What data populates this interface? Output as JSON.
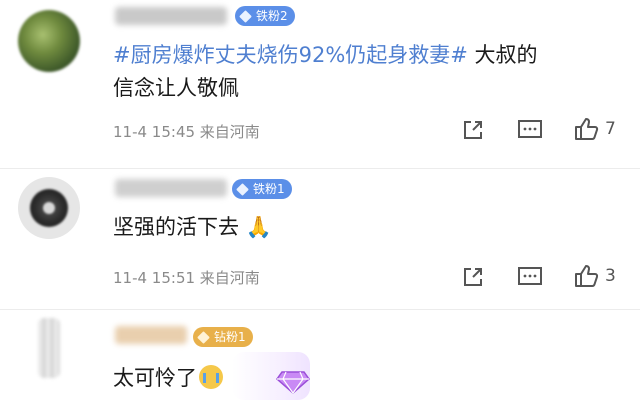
{
  "comments": [
    {
      "badge": "铁粉2",
      "topic": "#厨房爆炸丈夫烧伤92%仍起身救妻#",
      "text_line1_tail": " 大叔的",
      "text_line2": "信念让人敬佩",
      "meta": "11-4 15:45 来自河南",
      "likes": "7"
    },
    {
      "badge": "铁粉1",
      "text": "坚强的活下去",
      "meta": "11-4 15:51 来自河南",
      "likes": "3"
    },
    {
      "badge": "钻粉1",
      "text": "太可怜了"
    }
  ],
  "icons": [
    "share-icon",
    "comment-icon",
    "like-icon",
    "pray-emoji",
    "crying-emoji",
    "diamond-sticker-icon"
  ],
  "colors": {
    "topic": "#4f7fd0",
    "badge_blue": "#5b8fe8",
    "badge_gold": "#e8b04a",
    "meta": "#8a8a8a"
  }
}
